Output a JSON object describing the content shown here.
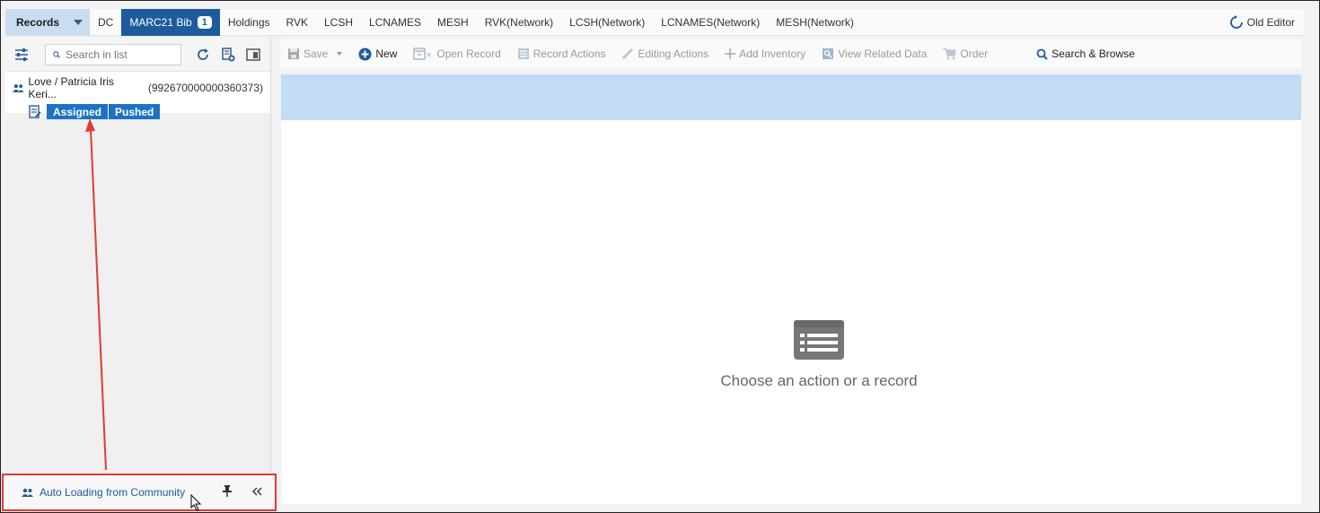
{
  "tabs": {
    "records_label": "Records",
    "items": [
      {
        "label": "DC"
      },
      {
        "label": "MARC21 Bib",
        "badge": "1",
        "active": true
      },
      {
        "label": "Holdings"
      },
      {
        "label": "RVK"
      },
      {
        "label": "LCSH"
      },
      {
        "label": "LCNAMES"
      },
      {
        "label": "MESH"
      },
      {
        "label": "RVK(Network)"
      },
      {
        "label": "LCSH(Network)"
      },
      {
        "label": "LCNAMES(Network)"
      },
      {
        "label": "MESH(Network)"
      }
    ],
    "old_editor": "Old Editor"
  },
  "left_panel": {
    "search_placeholder": "Search in list",
    "record": {
      "title": "Love / Patricia Iris Keri...",
      "mms_id": "(992670000000360373)",
      "tags": [
        "Assigned",
        "Pushed"
      ]
    },
    "bottom_label": "Auto Loading from Community"
  },
  "toolbar": {
    "save": "Save",
    "new": "New",
    "open_record": "Open Record",
    "record_actions": "Record Actions",
    "editing_actions": "Editing Actions",
    "add_inventory": "Add Inventory",
    "view_related_data": "View Related Data",
    "order": "Order",
    "search_browse": "Search & Browse"
  },
  "main": {
    "empty_text": "Choose an action or a record"
  },
  "colors": {
    "accent": "#1d5b9c",
    "tag_blue": "#1d72c4",
    "strip": "#c2dcf4",
    "annotation_red": "#e53935"
  }
}
